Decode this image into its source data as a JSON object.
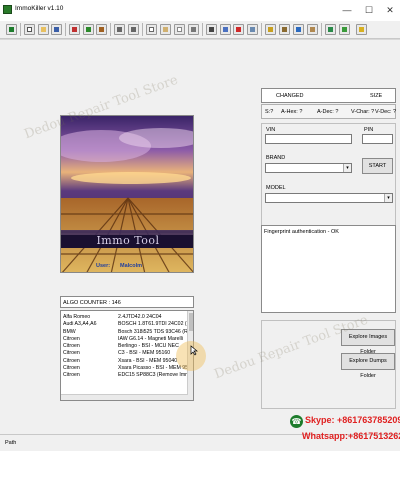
{
  "window": {
    "title": "ImmoKiller v1.10"
  },
  "title_controls": {
    "minimize": "—",
    "maximize": "☐",
    "close": "✕"
  },
  "banner": {
    "text": "Immo Tool"
  },
  "user": {
    "label": "User:",
    "name": "Malcolm"
  },
  "algo": {
    "counter_label": "ALGO COUNTER : 146"
  },
  "algo_list": [
    [
      "Alfa Romeo",
      "2.4JTD42.0   24C04"
    ],
    [
      "Audi A3,A4,A6",
      "BOSCH 1.8T61.9TDI   24C02 (Remov"
    ],
    [
      "BMW",
      "Bosch 318i525 TDS 93C46 (Remove"
    ],
    [
      "Citroen",
      "IAW G6.14 - Magneti Marelli"
    ],
    [
      "Citroen",
      "Berlingo - BSI - MCU NEC"
    ],
    [
      "Citroen",
      "C3 - BSI - MEM 95160"
    ],
    [
      "Citroen",
      "Xsara - BSI - MEM 95040"
    ],
    [
      "Citroen",
      "Xsara Picasso   - BSI - MEM 95040"
    ],
    [
      "Citroen",
      "EDC15 SP88C3 (Remove Immo)"
    ]
  ],
  "changed": {
    "title": "CHANGED",
    "size_label": "SIZE"
  },
  "hex_row": {
    "s": "S:?",
    "ahex": "A-Hex: ?",
    "adec": "A-Dec: ?",
    "vchar": "V-Char: ?",
    "vdec": "V-Dec: ?"
  },
  "fields": {
    "vin": "VIN",
    "pin": "PIN",
    "brand": "BRAND",
    "model": "MODEL"
  },
  "buttons": {
    "start": "START",
    "explore_images": "Explore Images Folder",
    "explore_dumps": "Explore Dumps Folder"
  },
  "log": {
    "text": "Fingerprint authentication - OK"
  },
  "status": {
    "path_label": "Path"
  },
  "watermark": {
    "line1": "Dedou Repair Tool Store",
    "line2": "Dedou Repair Tool Store"
  },
  "contact": {
    "skype": "Skype: +8617637852097",
    "whatsapp": "Whatsapp:+8617513262097"
  },
  "toolbar_icons": [
    "app-icon",
    "new-icon",
    "open-icon",
    "save-icon",
    "gear-icon",
    "chip-icon",
    "book-icon",
    "undo-icon",
    "redo-icon",
    "copy-icon",
    "paste-icon",
    "document-icon",
    "print-icon",
    "checksum-icon",
    "hex-icon",
    "calc-icon",
    "help-icon",
    "image-icon",
    "key-icon",
    "lock-icon",
    "refresh-icon",
    "clipboard-icon",
    "file-icon",
    "settings-icon",
    "exit-icon"
  ],
  "colors": {
    "accent_green": "#1d7c2c",
    "skype_red": "#e02020",
    "banner_purple": "#6a3e8e"
  }
}
